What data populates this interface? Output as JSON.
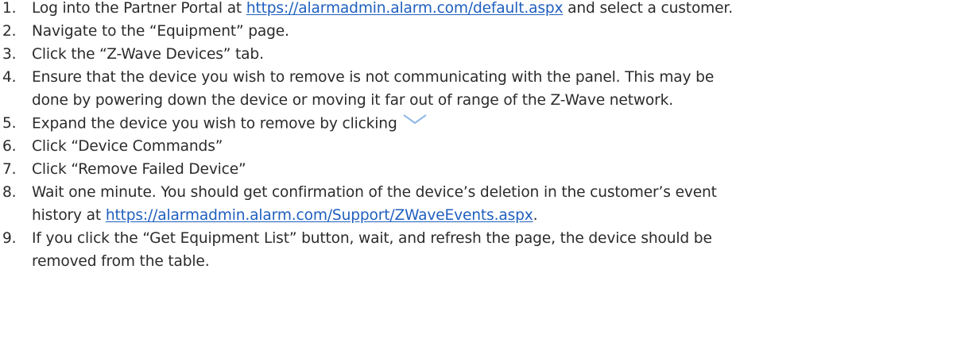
{
  "steps": [
    {
      "number": "1.",
      "before": "Log into the Partner Portal at ",
      "link": "https://alarmadmin.alarm.com/default.aspx",
      "after": " and select a customer."
    },
    {
      "number": "2.",
      "text": "Navigate to the “Equipment” page."
    },
    {
      "number": "3.",
      "text": "Click the “Z-Wave Devices” tab."
    },
    {
      "number": "4.",
      "line1": "Ensure that the device you wish to remove is not communicating with the panel. This may be",
      "line2": "done by powering down the device or moving it far out of range of the Z-Wave network."
    },
    {
      "number": "5.",
      "text": "Expand the device you wish to remove by clicking",
      "icon": "chevron-down-icon"
    },
    {
      "number": "6.",
      "text": "Click “Device Commands”"
    },
    {
      "number": "7.",
      "text": "Click “Remove Failed Device”"
    },
    {
      "number": "8.",
      "line1": "Wait one minute. You should get confirmation of the device’s deletion in the customer’s event",
      "line2_before": "history at ",
      "line2_link": "https://alarmadmin.alarm.com/Support/ZWaveEvents.aspx",
      "line2_after": "."
    },
    {
      "number": "9.",
      "line1": "If you click the “Get Equipment List” button, wait, and refresh the page, the device should be",
      "line2": "removed from the table."
    }
  ],
  "colors": {
    "text": "#2b2b2b",
    "link": "#1f5fbf",
    "chevron": "#8fb8e6"
  }
}
